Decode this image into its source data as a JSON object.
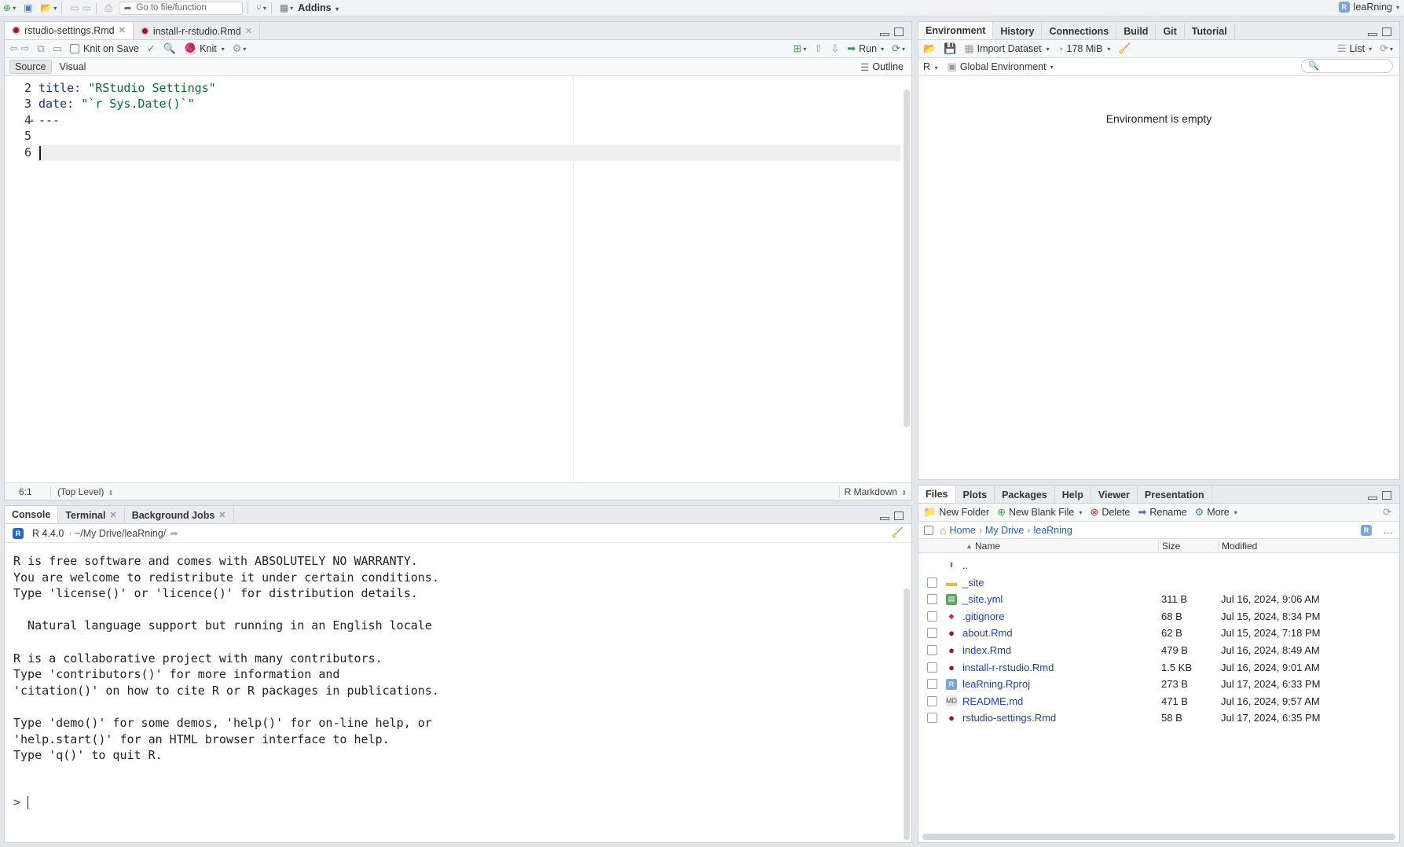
{
  "topbar": {
    "goto_placeholder": "Go to file/function",
    "addins_label": "Addins",
    "project_name": "leaRning"
  },
  "source": {
    "tabs": [
      {
        "label": "rstudio-settings.Rmd",
        "active": true
      },
      {
        "label": "install-r-rstudio.Rmd",
        "active": false
      }
    ],
    "toolbar": {
      "knit_on_save": "Knit on Save",
      "knit": "Knit",
      "run": "Run",
      "source_mode": "Source",
      "visual_mode": "Visual",
      "outline": "Outline"
    },
    "lines": [
      {
        "n": "2",
        "key": "title",
        "value": "\"RStudio Settings\""
      },
      {
        "n": "3",
        "key": "date",
        "value": "\"`r Sys.Date()`\""
      },
      {
        "n": "4",
        "text": "---"
      },
      {
        "n": "5",
        "text": ""
      },
      {
        "n": "6",
        "text": ""
      }
    ],
    "status": {
      "position": "6:1",
      "scope": "(Top Level)",
      "mode": "R Markdown"
    }
  },
  "console": {
    "tabs": [
      {
        "label": "Console",
        "active": true
      },
      {
        "label": "Terminal",
        "active": false
      },
      {
        "label": "Background Jobs",
        "active": false
      }
    ],
    "version": "R 4.4.0",
    "path": "· ~/My Drive/leaRning/",
    "output": [
      "R is free software and comes with ABSOLUTELY NO WARRANTY.",
      "You are welcome to redistribute it under certain conditions.",
      "Type 'license()' or 'licence()' for distribution details.",
      "",
      "  Natural language support but running in an English locale",
      "",
      "R is a collaborative project with many contributors.",
      "Type 'contributors()' for more information and",
      "'citation()' on how to cite R or R packages in publications.",
      "",
      "Type 'demo()' for some demos, 'help()' for on-line help, or",
      "'help.start()' for an HTML browser interface to help.",
      "Type 'q()' to quit R."
    ],
    "prompt": ">"
  },
  "environment": {
    "tabs": [
      {
        "label": "Environment",
        "active": true
      },
      {
        "label": "History",
        "active": false
      },
      {
        "label": "Connections",
        "active": false
      },
      {
        "label": "Build",
        "active": false
      },
      {
        "label": "Git",
        "active": false
      },
      {
        "label": "Tutorial",
        "active": false
      }
    ],
    "import_dataset": "Import Dataset",
    "memory": "178 MiB",
    "view_mode": "List",
    "language": "R",
    "scope": "Global Environment",
    "empty_message": "Environment is empty"
  },
  "files": {
    "tabs": [
      {
        "label": "Files",
        "active": true
      },
      {
        "label": "Plots",
        "active": false
      },
      {
        "label": "Packages",
        "active": false
      },
      {
        "label": "Help",
        "active": false
      },
      {
        "label": "Viewer",
        "active": false
      },
      {
        "label": "Presentation",
        "active": false
      }
    ],
    "toolbar": {
      "new_folder": "New Folder",
      "new_blank_file": "New Blank File",
      "delete": "Delete",
      "rename": "Rename",
      "more": "More"
    },
    "breadcrumb": [
      "Home",
      "My Drive",
      "leaRning"
    ],
    "columns": {
      "name": "Name",
      "size": "Size",
      "modified": "Modified"
    },
    "rows": [
      {
        "name": "..",
        "size": "",
        "modified": "",
        "icon": "up-arrow-icon"
      },
      {
        "name": "_site",
        "size": "",
        "modified": "",
        "icon": "folder-icon"
      },
      {
        "name": "_site.yml",
        "size": "311 B",
        "modified": "Jul 16, 2024, 9:06 AM",
        "icon": "yaml-file-icon"
      },
      {
        "name": ".gitignore",
        "size": "68 B",
        "modified": "Jul 15, 2024, 8:34 PM",
        "icon": "text-file-icon"
      },
      {
        "name": "about.Rmd",
        "size": "62 B",
        "modified": "Jul 15, 2024, 7:18 PM",
        "icon": "rmd-file-icon"
      },
      {
        "name": "index.Rmd",
        "size": "479 B",
        "modified": "Jul 16, 2024, 8:49 AM",
        "icon": "rmd-file-icon"
      },
      {
        "name": "install-r-rstudio.Rmd",
        "size": "1.5 KB",
        "modified": "Jul 16, 2024, 9:01 AM",
        "icon": "rmd-file-icon"
      },
      {
        "name": "leaRning.Rproj",
        "size": "273 B",
        "modified": "Jul 17, 2024, 6:33 PM",
        "icon": "rproj-file-icon"
      },
      {
        "name": "README.md",
        "size": "471 B",
        "modified": "Jul 16, 2024, 9:57 AM",
        "icon": "md-file-icon"
      },
      {
        "name": "rstudio-settings.Rmd",
        "size": "58 B",
        "modified": "Jul 17, 2024, 6:35 PM",
        "icon": "rmd-file-icon"
      }
    ]
  }
}
